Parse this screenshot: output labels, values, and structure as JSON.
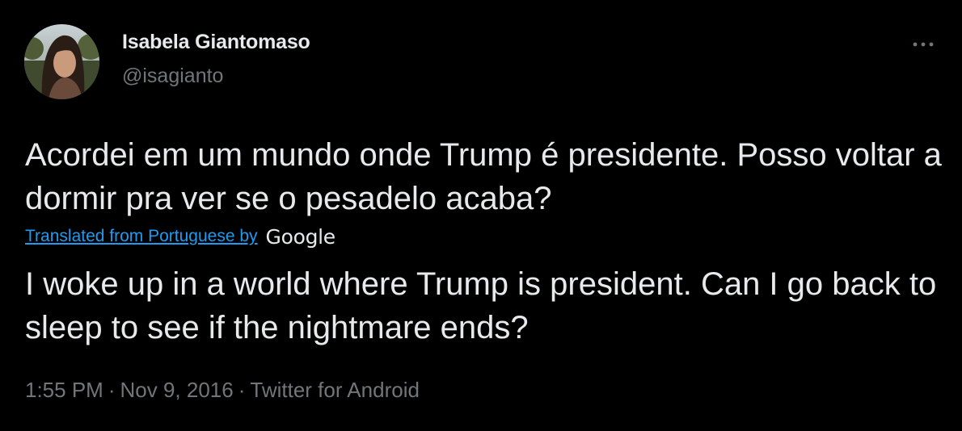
{
  "author": {
    "name": "Isabela Giantomaso",
    "handle": "@isagianto"
  },
  "tweet": {
    "original_text": "Acordei em um mundo onde Trump é presidente. Posso voltar a dormir pra ver se o pesadelo acaba?",
    "translation_label": "Translated from Portuguese by",
    "translation_provider": "Google",
    "translated_text": "I woke up in a world where Trump is president. Can I go back to sleep to see if the nightmare ends?"
  },
  "meta": {
    "time": "1:55 PM",
    "separator": "·",
    "date": "Nov 9, 2016",
    "source": "Twitter for Android"
  },
  "icons": {
    "more": "more-options-icon"
  },
  "colors": {
    "background": "#000000",
    "primary_text": "#e7e9ea",
    "secondary_text": "#71767b",
    "link": "#1d9bf0"
  }
}
